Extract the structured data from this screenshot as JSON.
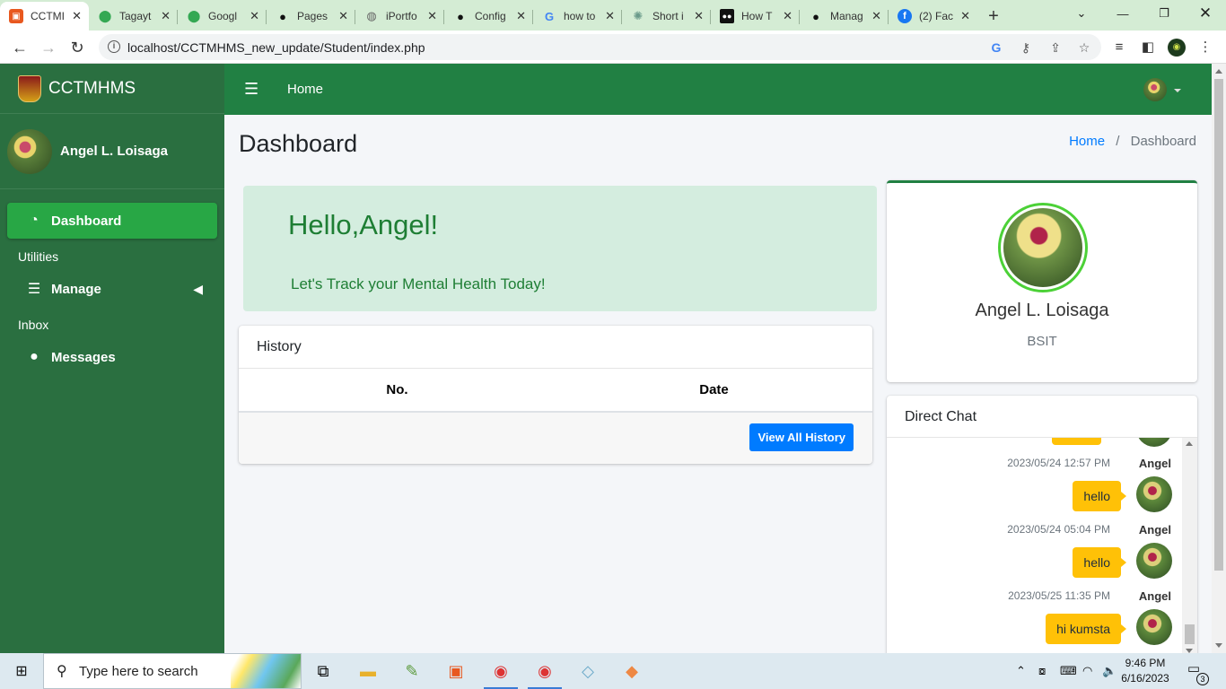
{
  "browser": {
    "tabs": [
      {
        "title": "CCTMI",
        "icon": "cctm-favicon",
        "active": true
      },
      {
        "title": "Tagayt",
        "icon": "maps-pin-icon"
      },
      {
        "title": "Googl",
        "icon": "maps-pin-icon"
      },
      {
        "title": "Pages",
        "icon": "github-icon"
      },
      {
        "title": "iPortfo",
        "icon": "globe-icon"
      },
      {
        "title": "Config",
        "icon": "github-icon"
      },
      {
        "title": "how to",
        "icon": "google-icon"
      },
      {
        "title": "Short i",
        "icon": "openai-icon"
      },
      {
        "title": "How T",
        "icon": "medium-icon"
      },
      {
        "title": "Manag",
        "icon": "github-icon"
      },
      {
        "title": "(2) Fac",
        "icon": "facebook-icon"
      }
    ],
    "url": "localhost/CCTMHMS_new_update/Student/index.php"
  },
  "sidebar": {
    "brand": "CCTMHMS",
    "user_name": "Angel L. Loisaga",
    "items": [
      {
        "type": "item",
        "label": "Dashboard",
        "icon": "dashboard-icon",
        "active": true
      },
      {
        "type": "header",
        "label": "Utilities"
      },
      {
        "type": "item",
        "label": "Manage",
        "icon": "list-icon",
        "has_caret": true
      },
      {
        "type": "header",
        "label": "Inbox"
      },
      {
        "type": "item",
        "label": "Messages",
        "icon": "comment-icon"
      }
    ]
  },
  "topbar": {
    "home": "Home"
  },
  "page": {
    "title": "Dashboard",
    "breadcrumb": {
      "home": "Home",
      "current": "Dashboard",
      "sep": "/"
    }
  },
  "hello": {
    "heading": "Hello,Angel!",
    "subtitle": "Let's Track your Mental Health Today!"
  },
  "history": {
    "title": "History",
    "columns": [
      "No.",
      "Date"
    ],
    "button": "View All History"
  },
  "profile": {
    "name": "Angel L. Loisaga",
    "course": "BSIT"
  },
  "chat": {
    "title": "Direct Chat",
    "messages": [
      {
        "time": "2023/05/24 12:57 PM",
        "name": "Angel",
        "text": "hello"
      },
      {
        "time": "2023/05/24 05:04 PM",
        "name": "Angel",
        "text": "hello"
      },
      {
        "time": "2023/05/25 11:35 PM",
        "name": "Angel",
        "text": "hi kumsta"
      }
    ]
  },
  "taskbar": {
    "search_placeholder": "Type here to search",
    "time": "9:46 PM",
    "date": "6/16/2023",
    "notification_count": "3"
  },
  "colors": {
    "sidebar": "#2a6f40",
    "topbar": "#218043",
    "active": "#28a745",
    "chat_bubble": "#ffc107",
    "primary_button": "#007bff"
  }
}
